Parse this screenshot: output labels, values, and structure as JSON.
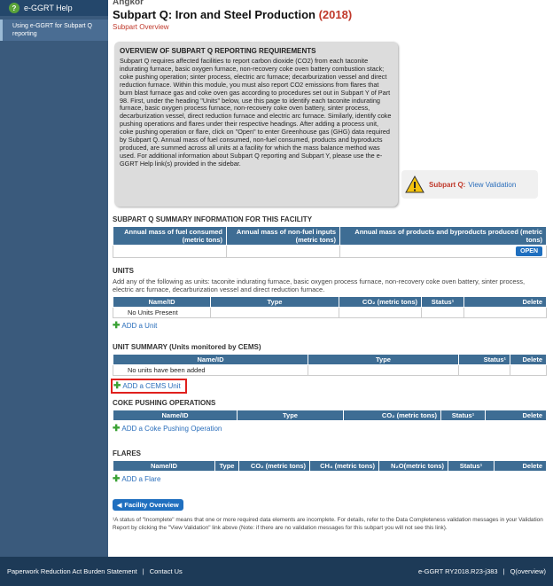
{
  "sidebar": {
    "help_title": "e-GGRT Help",
    "help_link": "Using e-GGRT for Subpart Q reporting"
  },
  "header": {
    "facility": "Angkor",
    "title": "Subpart Q: Iron and Steel Production",
    "year": "(2018)",
    "subtitle": "Subpart Overview"
  },
  "overview": {
    "heading": "OVERVIEW OF SUBPART Q REPORTING REQUIREMENTS",
    "body": "Subpart Q requires affected facilities to report carbon dioxide (CO2) from each taconite indurating furnace, basic oxygen furnace, non-recovery coke oven battery combustion stack; coke pushing operation; sinter process, electric arc furnace; decarburization vessel and direct reduction furnace. Within this module, you must also report CO2 emissions from flares that burn blast furnace gas and coke oven gas according to procedures set out in Subpart Y of Part 98. First, under the heading \"Units\" below, use this page to identify each taconite indurating furnace, basic oxygen process furnace, non-recovery coke oven battery, sinter process, decarburization vessel, direct reduction furnace and electric arc furnace. Similarly, identify coke pushing operations and flares under their respective headings. After adding a process unit, coke pushing operation or flare, click on \"Open\" to enter Greenhouse gas (GHG) data required by Subpart Q. Annual mass of fuel consumed, non-fuel consumed, products and byproducts produced, are summed across all units at a facility for which the mass balance method was used. For additional information about Subpart Q reporting and Subpart Y, please use the e-GGRT Help link(s) provided in the sidebar."
  },
  "validation": {
    "label": "Subpart Q:",
    "link": "View Validation"
  },
  "summary": {
    "title": "SUBPART Q SUMMARY INFORMATION FOR THIS FACILITY",
    "columns": [
      "Annual mass of fuel consumed (metric tons)",
      "Annual mass of non-fuel inputs (metric tons)",
      "Annual mass of products and byproducts produced (metric tons)"
    ],
    "open_label": "OPEN"
  },
  "units": {
    "title": "UNITS",
    "description": "Add any of the following as units: taconite indurating furnace, basic oxygen process furnace, non-recovery coke oven battery, sinter process, electric arc furnace, decarburization vessel and direct reduction furnace.",
    "columns": [
      "Name/ID",
      "Type",
      "CO₂ (metric tons)",
      "Status¹",
      "Delete"
    ],
    "empty": "No Units Present",
    "add_label": "ADD a Unit"
  },
  "unit_summary": {
    "title": "UNIT SUMMARY (Units monitored by CEMS)",
    "columns": [
      "Name/ID",
      "Type",
      "Status¹",
      "Delete"
    ],
    "empty": "No units have been added",
    "add_label": "ADD a CEMS Unit"
  },
  "coke": {
    "title": "COKE PUSHING OPERATIONS",
    "columns": [
      "Name/ID",
      "Type",
      "CO₂ (metric tons)",
      "Status¹",
      "Delete"
    ],
    "add_label": "ADD a Coke Pushing Operation"
  },
  "flares": {
    "title": "FLARES",
    "columns": [
      "Name/ID",
      "Type",
      "CO₂ (metric tons)",
      "CH₄ (metric tons)",
      "N₂O(metric tons)",
      "Status¹",
      "Delete"
    ],
    "add_label": "ADD a Flare"
  },
  "facility_button": "Facility Overview",
  "footnote": "¹A status of \"Incomplete\" means that one or more required data elements are incomplete. For details, refer to the Data Completeness validation messages in your Validation Report by clicking the \"View Validation\" link above (Note: if there are no validation messages for this subpart you will not see this link).",
  "footer": {
    "paperwork": "Paperwork Reduction Act Burden Statement",
    "contact": "Contact Us",
    "version": "e-GGRT RY2018.R23-j383",
    "page": "Q(overview)"
  },
  "colors": {
    "header_blue": "#3e6d94",
    "footer_navy": "#1d3a57",
    "accent_red": "#c0392b",
    "link_blue": "#2a6ebb"
  }
}
